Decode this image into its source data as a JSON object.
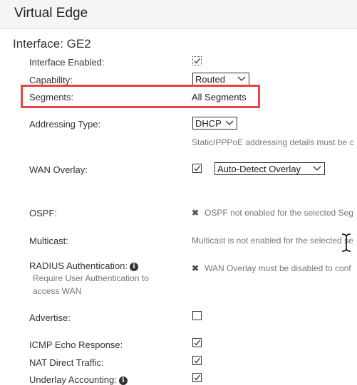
{
  "header": {
    "title": "Virtual Edge"
  },
  "section": {
    "title": "Interface: GE2"
  },
  "fields": {
    "interface_enabled": {
      "label": "Interface Enabled:",
      "checked": true
    },
    "capability": {
      "label": "Capability:",
      "value": "Routed"
    },
    "segments": {
      "label": "Segments:",
      "value": "All Segments"
    },
    "addressing_type": {
      "label": "Addressing Type:",
      "value": "DHCP",
      "note": "Static/PPPoE addressing details must be c"
    },
    "wan_overlay": {
      "label": "WAN Overlay:",
      "checked": true,
      "value": "Auto-Detect Overlay"
    },
    "ospf": {
      "label": "OSPF:",
      "note": "OSPF not enabled for the selected Seg"
    },
    "multicast": {
      "label": "Multicast:",
      "note": "Multicast is not enabled for the selected se"
    },
    "radius": {
      "label": "RADIUS Authentication:",
      "sublabel": "Require User Authentication to access WAN",
      "note": "WAN Overlay must be disabled to conf"
    },
    "advertise": {
      "label": "Advertise:",
      "checked": false
    },
    "icmp_echo": {
      "label": "ICMP Echo Response:",
      "checked": true
    },
    "nat_direct": {
      "label": "NAT Direct Traffic:",
      "checked": true
    },
    "underlay_accounting": {
      "label": "Underlay Accounting:",
      "checked": true
    }
  },
  "icons": {
    "x_glyph": "✖",
    "info_glyph": "i"
  },
  "colors": {
    "highlight": "#e8424a"
  }
}
